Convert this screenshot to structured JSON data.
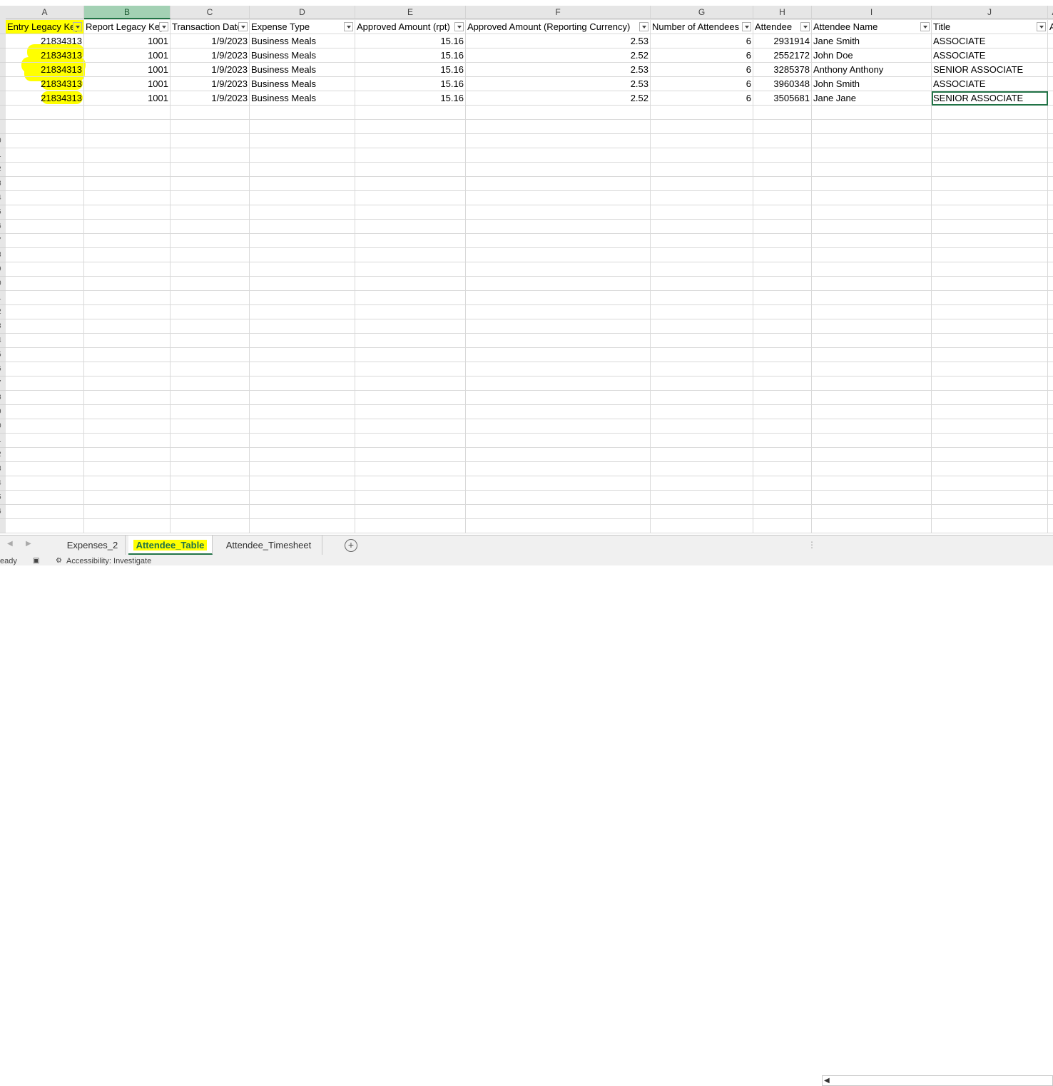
{
  "columns": [
    {
      "letter": "A"
    },
    {
      "letter": "B"
    },
    {
      "letter": "C"
    },
    {
      "letter": "D"
    },
    {
      "letter": "E"
    },
    {
      "letter": "F"
    },
    {
      "letter": "G"
    },
    {
      "letter": "H"
    },
    {
      "letter": "I"
    },
    {
      "letter": "J"
    },
    {
      "letter": "A"
    }
  ],
  "headers": [
    "Entry Legacy Key",
    "Report Legacy Key",
    "Transaction Date",
    "Expense Type",
    "Approved Amount (rpt)",
    "Approved Amount (Reporting Currency)",
    "Number of Attendees",
    "Attendee",
    "Attendee Name",
    "Title",
    "A"
  ],
  "rows": [
    [
      "21834313",
      "1001",
      "1/9/2023",
      "Business Meals",
      "15.16",
      "2.53",
      "6",
      "2931914",
      "Jane Smith",
      "ASSOCIATE"
    ],
    [
      "21834313",
      "1001",
      "1/9/2023",
      "Business Meals",
      "15.16",
      "2.52",
      "6",
      "2552172",
      "John Doe",
      "ASSOCIATE"
    ],
    [
      "21834313",
      "1001",
      "1/9/2023",
      "Business Meals",
      "15.16",
      "2.53",
      "6",
      "3285378",
      "Anthony Anthony",
      "SENIOR ASSOCIATE"
    ],
    [
      "21834313",
      "1001",
      "1/9/2023",
      "Business Meals",
      "15.16",
      "2.53",
      "6",
      "3960348",
      "John Smith",
      "ASSOCIATE"
    ],
    [
      "21834313",
      "1001",
      "1/9/2023",
      "Business Meals",
      "15.16",
      "2.52",
      "6",
      "3505681",
      "Jane Jane",
      "SENIOR ASSOCIATE"
    ]
  ],
  "row_number_fragments": [
    "0",
    "1",
    "2",
    "3",
    "4",
    "5",
    "6",
    "7",
    "8",
    "9",
    "0",
    "1",
    "2",
    "3",
    "4",
    "5",
    "6",
    "7",
    "8",
    "9",
    "0",
    "1",
    "2",
    "3",
    "4",
    "5",
    "6"
  ],
  "sheet_tabs": {
    "tabs": [
      "Expenses_2",
      "Attendee_Table",
      "Attendee_Timesheet"
    ],
    "active": "Attendee_Table",
    "add_label": "+"
  },
  "status_bar": {
    "ready": "eady",
    "accessibility": "Accessibility: Investigate"
  },
  "colors": {
    "highlight": "#ffff00",
    "excel_green": "#217346",
    "selected_col_header": "#a3d1b4"
  }
}
